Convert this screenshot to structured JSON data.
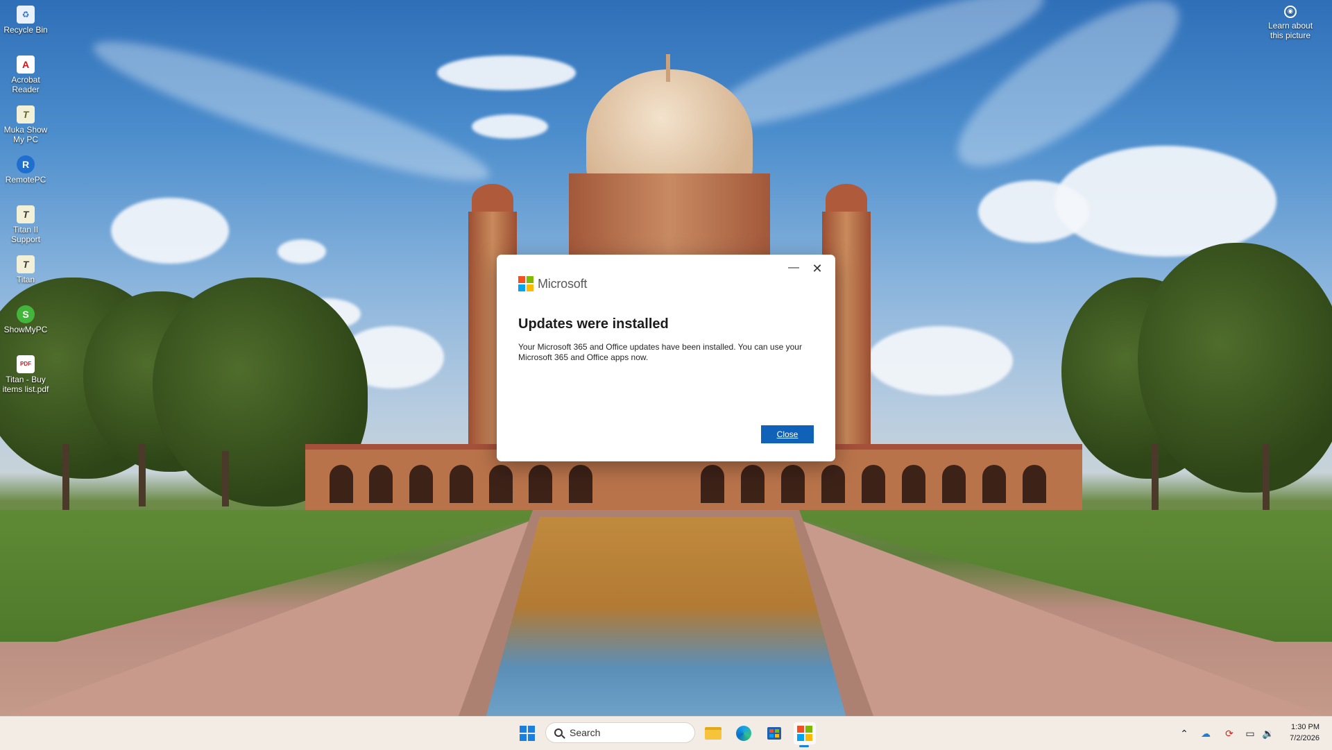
{
  "desktop_icons": [
    {
      "label": "Recycle Bin",
      "icon": "recycle-bin-icon"
    },
    {
      "label": "Acrobat Reader",
      "icon": "acrobat-reader-icon"
    },
    {
      "label": "Muka Show My PC",
      "icon": "muka-show-my-pc-icon"
    },
    {
      "label": "RemotePC",
      "icon": "remotepc-icon"
    },
    {
      "label": "Titan II Support",
      "icon": "titan-support-icon"
    },
    {
      "label": "Titan",
      "icon": "titan-icon"
    },
    {
      "label": "ShowMyPC",
      "icon": "showmypc-icon"
    },
    {
      "label": "Titan - Buy items list.pdf",
      "icon": "pdf-file-icon"
    }
  ],
  "learn_about": {
    "label": "Learn about this picture",
    "icon": "camera-icon"
  },
  "dialog": {
    "brand": "Microsoft",
    "title": "Updates were installed",
    "message": "Your Microsoft 365 and Office updates have been installed. You can use your Microsoft 365 and Office apps now.",
    "close_button": "Close",
    "minimize_glyph": "—",
    "close_glyph": "✕",
    "logo_colors": [
      "#f25022",
      "#7fba00",
      "#00a4ef",
      "#ffb900"
    ]
  },
  "taskbar": {
    "search_placeholder": "Search",
    "apps": [
      "start-icon",
      "search-icon",
      "file-explorer-icon",
      "edge-icon",
      "store-icon",
      "microsoft-office-icon"
    ],
    "tray": [
      "chevron-up-icon",
      "onedrive-icon",
      "update-icon",
      "network-icon",
      "volume-icon"
    ],
    "time": "1:30 PM",
    "date": "7/2/2026"
  },
  "colors": {
    "accent": "#0f62b8",
    "taskbar": "#f2ece4"
  }
}
